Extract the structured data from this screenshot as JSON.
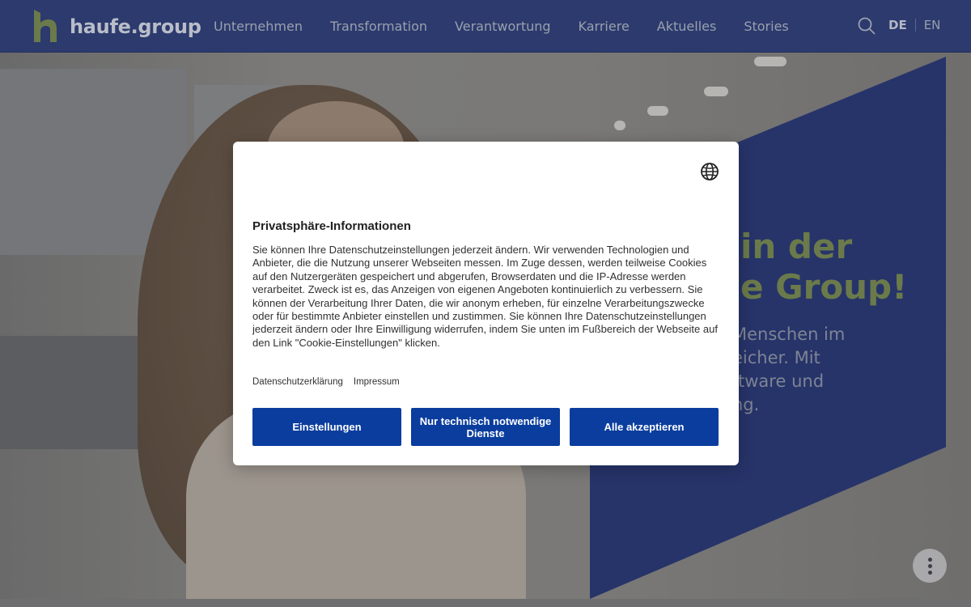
{
  "header": {
    "logo_text": "haufe.group",
    "nav": [
      "Unternehmen",
      "Transformation",
      "Verantwortung",
      "Karriere",
      "Aktuelles",
      "Stories"
    ],
    "search_icon": "search-icon",
    "lang_de": "DE",
    "lang_en": "EN"
  },
  "hero": {
    "title": "in der\ne Group!",
    "text": "Menschen im\neicher. Mit\nftware und\nng."
  },
  "dialog": {
    "globe_icon": "globe-icon",
    "title": "Privatsphäre-Informationen",
    "body": "Sie können Ihre Datenschutzeinstellungen jederzeit ändern. Wir verwenden Technologien und Anbieter, die die Nutzung unserer Webseiten messen. Im Zuge dessen, werden teilweise Cookies auf den Nutzergeräten gespeichert und abgerufen, Browserdaten und die IP-Adresse werden verarbeitet. Zweck ist es, das Anzeigen von eigenen Angeboten kontinuierlich zu verbessern. Sie können der Verarbeitung Ihrer Daten, die wir anonym erheben, für einzelne Verarbeitungszwecke oder für bestimmte Anbieter einstellen und zustimmen. Sie können Ihre Datenschutzeinstellungen jederzeit ändern oder Ihre Einwilligung widerrufen, indem Sie unten im Fußbereich der Webseite auf den Link \"Cookie-Einstellungen\" klicken.",
    "links": [
      "Datenschutzerklärung",
      "Impressum"
    ],
    "buttons": {
      "settings": "Einstellungen",
      "necessary": "Nur technisch notwendige Dienste",
      "accept_all": "Alle akzeptieren"
    }
  },
  "fab_icon": "more-vertical-icon",
  "colors": {
    "header_bg": "#2c3a6e",
    "brand_green": "#6b7a4a",
    "button_blue": "#0a3d9e"
  }
}
